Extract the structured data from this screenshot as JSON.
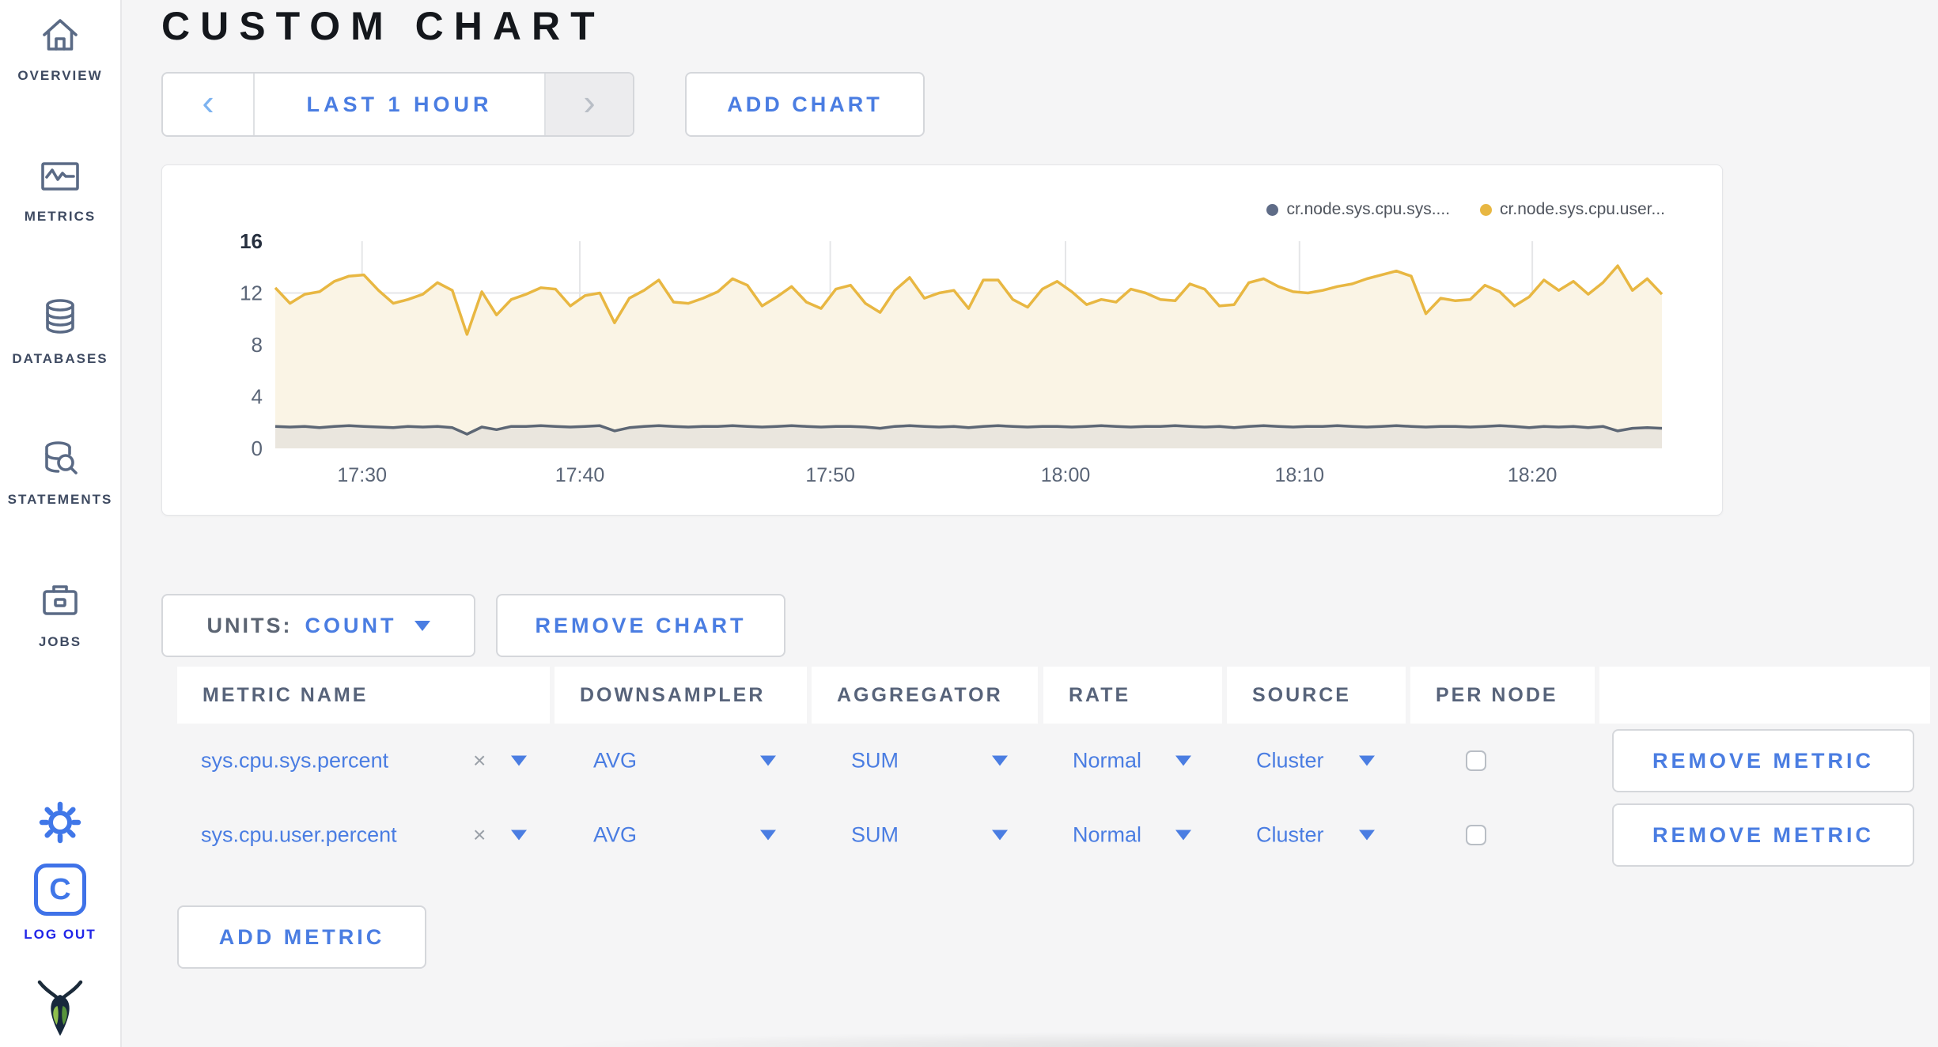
{
  "colors": {
    "accent_blue": "#4a7de2",
    "logout_blue": "#2125e8",
    "sidebar_icon": "#5a6a85",
    "title_black": "#14171c",
    "page_background": "#f5f5f6"
  },
  "sidebar": {
    "items": [
      {
        "label": "OVERVIEW",
        "icon": "home-icon"
      },
      {
        "label": "METRICS",
        "icon": "metrics-icon"
      },
      {
        "label": "DATABASES",
        "icon": "databases-icon"
      },
      {
        "label": "STATEMENTS",
        "icon": "statements-icon"
      },
      {
        "label": "JOBS",
        "icon": "jobs-icon"
      }
    ],
    "gear_icon": "gear-icon",
    "logo_letter": "C",
    "log_out_label": "LOG OUT",
    "brand_icon": "cockroach-bug-icon"
  },
  "header": {
    "title": "CUSTOM CHART"
  },
  "toolbar": {
    "prev_glyph": "‹",
    "next_glyph": "›",
    "time_range_label": "LAST 1 HOUR",
    "add_chart_label": "ADD CHART"
  },
  "chart_data": {
    "type": "line",
    "title": "",
    "xlabel": "",
    "ylabel": "",
    "x_range": "17:26 to 18:25",
    "x_ticks": [
      "17:30",
      "17:40",
      "17:50",
      "18:00",
      "18:10",
      "18:20"
    ],
    "x_tick_fractions": [
      0.0626,
      0.2196,
      0.4002,
      0.5699,
      0.7386,
      0.9065
    ],
    "ylim": [
      0,
      16
    ],
    "y_ticks": [
      0,
      4,
      8,
      12,
      16
    ],
    "y_gridlines": [
      4,
      8,
      12
    ],
    "grid_color": "#e5e6e8",
    "tick_color": "#5a6577",
    "legend_position": "top-right",
    "series": [
      {
        "name": "cr.node.sys.cpu.sys....",
        "dot_color": "#5f6c87",
        "color": "#5d6775",
        "fill": "#eae6de",
        "values": [
          1.7,
          1.65,
          1.7,
          1.6,
          1.7,
          1.75,
          1.7,
          1.65,
          1.6,
          1.7,
          1.65,
          1.7,
          1.6,
          1.1,
          1.65,
          1.45,
          1.7,
          1.7,
          1.75,
          1.7,
          1.65,
          1.7,
          1.75,
          1.35,
          1.6,
          1.7,
          1.75,
          1.7,
          1.65,
          1.7,
          1.7,
          1.75,
          1.7,
          1.65,
          1.7,
          1.75,
          1.7,
          1.65,
          1.7,
          1.7,
          1.65,
          1.55,
          1.7,
          1.75,
          1.7,
          1.65,
          1.7,
          1.6,
          1.7,
          1.75,
          1.7,
          1.65,
          1.7,
          1.7,
          1.65,
          1.7,
          1.75,
          1.7,
          1.65,
          1.7,
          1.7,
          1.75,
          1.7,
          1.65,
          1.7,
          1.6,
          1.7,
          1.75,
          1.7,
          1.65,
          1.7,
          1.7,
          1.75,
          1.7,
          1.65,
          1.7,
          1.75,
          1.7,
          1.65,
          1.7,
          1.7,
          1.65,
          1.7,
          1.75,
          1.7,
          1.6,
          1.7,
          1.65,
          1.7,
          1.6,
          1.7,
          1.35,
          1.55,
          1.6,
          1.55
        ]
      },
      {
        "name": "cr.node.sys.cpu.user...",
        "dot_color": "#e8b742",
        "color": "#e8b742",
        "fill": "#faf4e5",
        "values": [
          12.4,
          11.2,
          11.9,
          12.1,
          12.9,
          13.3,
          13.4,
          12.2,
          11.2,
          11.5,
          11.9,
          12.8,
          12.2,
          8.8,
          12.1,
          10.3,
          11.5,
          11.9,
          12.4,
          12.3,
          11.0,
          11.8,
          12.0,
          9.7,
          11.6,
          12.2,
          13.0,
          11.3,
          11.2,
          11.6,
          12.1,
          13.1,
          12.6,
          11.0,
          11.7,
          12.5,
          11.3,
          10.8,
          12.3,
          12.6,
          11.2,
          10.5,
          12.2,
          13.2,
          11.6,
          12.0,
          12.2,
          10.8,
          13.0,
          13.0,
          11.5,
          10.9,
          12.3,
          12.9,
          12.1,
          11.1,
          11.5,
          11.3,
          12.3,
          12.0,
          11.5,
          11.4,
          12.7,
          12.3,
          11.0,
          11.1,
          12.8,
          13.1,
          12.5,
          12.1,
          12.0,
          12.2,
          12.5,
          12.7,
          13.1,
          13.4,
          13.7,
          13.3,
          10.4,
          11.6,
          11.4,
          11.5,
          12.6,
          12.1,
          11.0,
          11.7,
          13.0,
          12.2,
          12.9,
          11.9,
          12.8,
          14.1,
          12.2,
          13.1,
          11.9
        ]
      }
    ]
  },
  "units_bar": {
    "units_label": "UNITS:",
    "units_value": "COUNT",
    "remove_chart_label": "REMOVE CHART"
  },
  "metrics_table": {
    "columns": [
      "METRIC NAME",
      "DOWNSAMPLER",
      "AGGREGATOR",
      "RATE",
      "SOURCE",
      "PER NODE"
    ],
    "clear_glyph": "×",
    "rows": [
      {
        "name": "sys.cpu.sys.percent",
        "downsampler": "AVG",
        "aggregator": "SUM",
        "rate": "Normal",
        "source": "Cluster",
        "per_node_checked": false,
        "remove_label": "REMOVE METRIC"
      },
      {
        "name": "sys.cpu.user.percent",
        "downsampler": "AVG",
        "aggregator": "SUM",
        "rate": "Normal",
        "source": "Cluster",
        "per_node_checked": false,
        "remove_label": "REMOVE METRIC"
      }
    ],
    "add_metric_label": "ADD METRIC"
  }
}
